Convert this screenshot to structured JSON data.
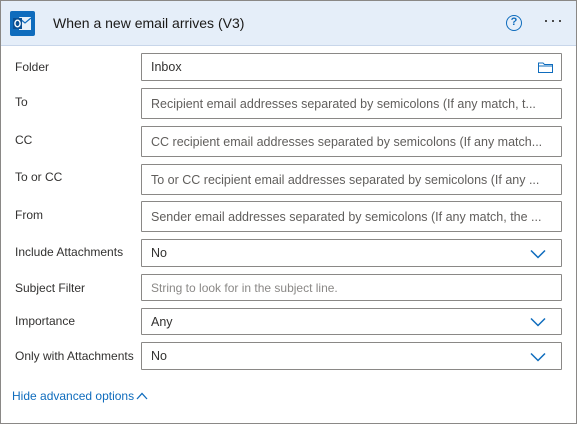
{
  "header": {
    "title": "When a new email arrives (V3)",
    "help_glyph": "?",
    "more_glyph": "···",
    "accent": "#0f6cbd",
    "background": "#e5eef9"
  },
  "fields": {
    "folder": {
      "label": "Folder",
      "value": "Inbox",
      "icon": "folder-icon"
    },
    "to": {
      "label": "To",
      "placeholder": "Recipient email addresses separated by semicolons (If any match, t..."
    },
    "cc": {
      "label": "CC",
      "placeholder": "CC recipient email addresses separated by semicolons (If any match..."
    },
    "to_or_cc": {
      "label": "To or CC",
      "placeholder": "To or CC recipient email addresses separated by semicolons (If any ..."
    },
    "from": {
      "label": "From",
      "placeholder": "Sender email addresses separated by semicolons (If any match, the ..."
    },
    "include_attachments": {
      "label": "Include Attachments",
      "value": "No",
      "icon": "chevron-down-icon"
    },
    "subject_filter": {
      "label": "Subject Filter",
      "placeholder": "String to look for in the subject line."
    },
    "importance": {
      "label": "Importance",
      "value": "Any",
      "icon": "chevron-down-icon"
    },
    "only_with_attachments": {
      "label": "Only with Attachments",
      "value": "No",
      "icon": "chevron-down-icon"
    }
  },
  "footer": {
    "hide_advanced_label": "Hide advanced options",
    "icon": "chevron-up-icon"
  }
}
